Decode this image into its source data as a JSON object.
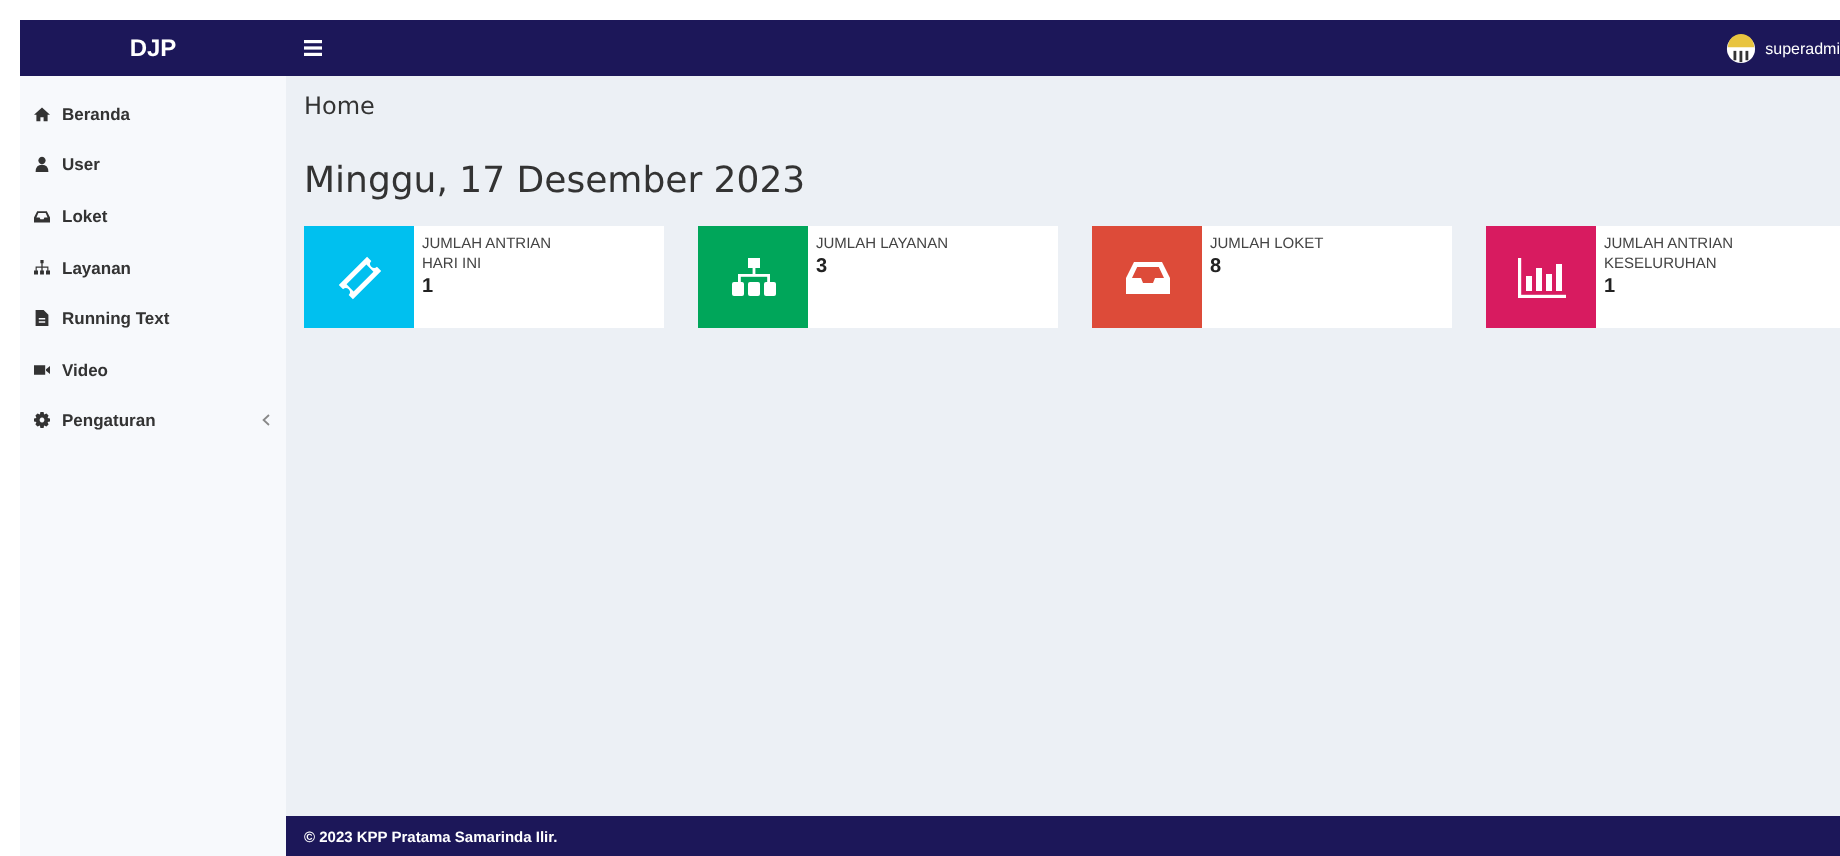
{
  "header": {
    "brand": "DJP",
    "user": "superadmi"
  },
  "sidebar": {
    "items": [
      {
        "label": "Beranda",
        "kind": "home",
        "submenu": false
      },
      {
        "label": "User",
        "kind": "user",
        "submenu": false
      },
      {
        "label": "Loket",
        "kind": "inbox",
        "submenu": false
      },
      {
        "label": "Layanan",
        "kind": "sitemap",
        "submenu": false
      },
      {
        "label": "Running Text",
        "kind": "file",
        "submenu": false
      },
      {
        "label": "Video",
        "kind": "video",
        "submenu": false
      },
      {
        "label": "Pengaturan",
        "kind": "gear",
        "submenu": true
      }
    ]
  },
  "breadcrumb": "Home",
  "date_heading": "Minggu, 17 Desember 2023",
  "cards": [
    {
      "label": "JUMLAH ANTRIAN HARI INI",
      "value": "1",
      "kind": "ticket",
      "color": "#00c0ef"
    },
    {
      "label": "JUMLAH LAYANAN",
      "value": "3",
      "kind": "sitemap",
      "color": "#00a65a"
    },
    {
      "label": "JUMLAH LOKET",
      "value": "8",
      "kind": "inbox",
      "color": "#dd4b39"
    },
    {
      "label": "JUMLAH ANTRIAN KESELURUHAN",
      "value": "1",
      "kind": "chart",
      "color": "#d81b60"
    }
  ],
  "footer": "© 2023 KPP Pratama Samarinda Ilir."
}
